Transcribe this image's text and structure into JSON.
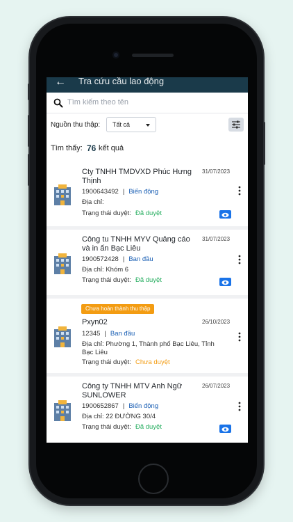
{
  "app": {
    "title": "Tra cứu cầu lao động",
    "back_icon": "arrow-left-icon"
  },
  "search": {
    "placeholder": "Tìm kiếm theo tên",
    "icon": "search-icon"
  },
  "filter": {
    "label": "Nguồn thu thập:",
    "selected": "Tất cả",
    "adjust_icon": "sliders-icon"
  },
  "result": {
    "prefix": "Tìm thấy:",
    "count": "76",
    "suffix": "kết quả"
  },
  "cards": [
    {
      "name": "Cty TNHH TMDVXD Phúc Hưng Thịnh",
      "date": "31/07/2023",
      "phone": "1900643492",
      "source": "Biến động",
      "address_label": "Địa chỉ:",
      "address": "",
      "status_label": "Trạng thái duyệt:",
      "status": "Đã duyệt"
    },
    {
      "name": "Công tu TNHH MYV Quảng cáo và in ấn Bạc Liêu",
      "date": "31/07/2023",
      "phone": "1900572428",
      "source": "Ban đầu",
      "address_label": "Địa chỉ:",
      "address": "Khóm 6",
      "status_label": "Trạng thái duyệt:",
      "status": "Đã duyệt"
    },
    {
      "badge": "Chưa hoàn thành thu thập",
      "name": "Pxyn02",
      "date": "26/10/2023",
      "phone": "12345",
      "source": "Ban đầu",
      "address_label": "Địa chỉ:",
      "address": "Phường 1, Thành phố Bạc Liêu, Tỉnh Bạc Liêu",
      "status_label": "Trạng thái duyệt:",
      "status": "Chưa duyệt"
    },
    {
      "name": "Công ty TNHH MTV Anh Ngữ SUNLOWER",
      "date": "26/07/2023",
      "phone": "1900652867",
      "source": "Biến động",
      "address_label": "Địa chỉ:",
      "address": "22 ĐƯỜNG 30/4",
      "status_label": "Trạng thái duyệt:",
      "status": "Đã duyệt"
    }
  ],
  "colors": {
    "header_bg": "#1a3a4a",
    "approved": "#27ae60",
    "pending": "#f39c12",
    "source_link": "#1a5fb4",
    "eye_button": "#1a73e8"
  }
}
